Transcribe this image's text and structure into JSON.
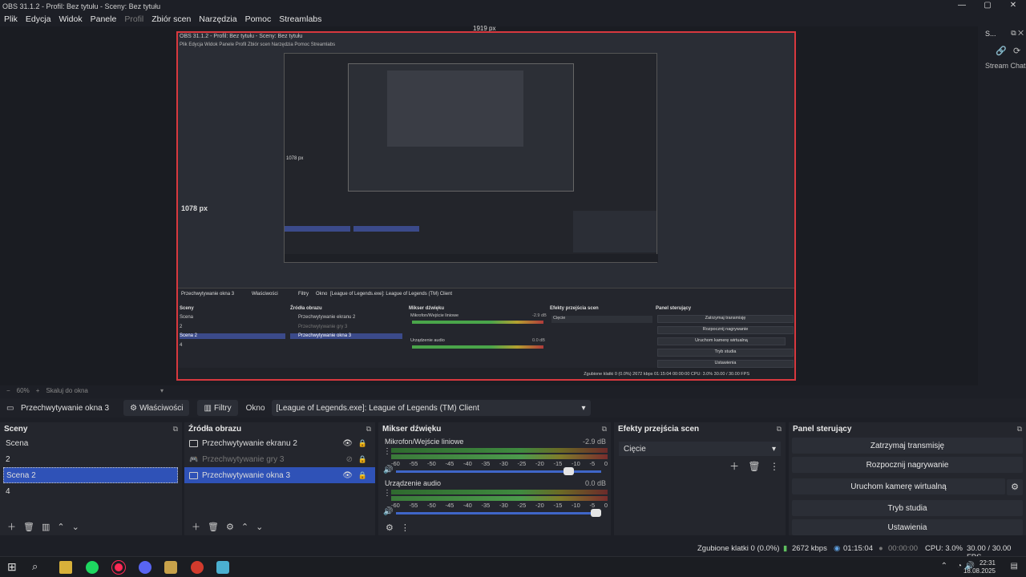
{
  "window": {
    "title": "OBS 31.1.2 - Profil: Bez tytułu - Sceny: Bez tytułu",
    "controls": [
      "—",
      "▢",
      "✕"
    ]
  },
  "menu": [
    "Plik",
    "Edycja",
    "Widok",
    "Panele",
    "Profil",
    "Zbiór scen",
    "Narzędzia",
    "Pomoc",
    "Streamlabs"
  ],
  "preview": {
    "top_px_label": "1919 px",
    "left_px_label": "1078 px",
    "nested": {
      "title": "OBS 31.1.2 - Profil: Bez tytułu - Sceny: Bez tytułu",
      "menu": "Plik  Edycja  Widok  Panele  Profil  Zbiór scen  Narzędzia  Pomoc  Streamlabs",
      "inner_px": "1078 px",
      "source_name": "Przechwytywanie okna 3",
      "props": "Właściwości",
      "filters": "Filtry",
      "okno": "Okno",
      "window_sel": "[League of Legends.exe]: League of Legends (TM) Client",
      "docks": {
        "scenes": "Sceny",
        "sources": "Źródła obrazu",
        "mixer": "Mikser dźwięku",
        "transitions": "Efekty przejścia scen",
        "controls": "Panel sterujący"
      },
      "scene_items": [
        "Scena",
        "2",
        "Scena 2",
        "4"
      ],
      "source_items": [
        "Przechwytywanie ekranu 2",
        "Przechwytywanie gry 3",
        "Przechwytywanie okna 3"
      ],
      "mic": "Mikrofon/Wejście liniowe",
      "mic_db": "-2.9 dB",
      "audio": "Urządzenie audio",
      "audio_db": "0.0 dB",
      "transition": "Cięcie",
      "buttons": [
        "Zatrzymaj transmisję",
        "Rozpocznij nagrywanie",
        "Uruchom kamerę wirtualną",
        "Tryb studia",
        "Ustawienia"
      ],
      "status": "Zgubione klatki 0 (0.0%)   2672 kbps   01:15:04   00:00:00   CPU: 3.0%   30.00 / 30.00 FPS"
    }
  },
  "right_dock": {
    "title": "S...",
    "label": "Stream Chat"
  },
  "zoom": {
    "minus": "−",
    "value": "60%",
    "plus": "+",
    "fit": "Skaluj do okna"
  },
  "source_bar": {
    "name": "Przechwytywanie okna 3",
    "properties": "Właściwości",
    "filters": "Filtry",
    "window_label": "Okno",
    "window_value": "[League of Legends.exe]: League of Legends (TM) Client"
  },
  "scenes": {
    "title": "Sceny",
    "items": [
      "Scena",
      "2",
      "Scena 2",
      "4"
    ],
    "selected": 2
  },
  "sources": {
    "title": "Źródła obrazu",
    "items": [
      {
        "label": "Przechwytywanie ekranu 2",
        "state": "visible"
      },
      {
        "label": "Przechwytywanie gry 3",
        "state": "hidden"
      },
      {
        "label": "Przechwytywanie okna 3",
        "state": "selected"
      }
    ]
  },
  "mixer": {
    "title": "Mikser dźwięku",
    "channels": [
      {
        "name": "Mikrofon/Wejście liniowe",
        "db": "-2.9 dB",
        "volume": 0.86
      },
      {
        "name": "Urządzenie audio",
        "db": "0.0 dB",
        "volume": 1.0
      }
    ],
    "scale": [
      "-60",
      "-55",
      "-50",
      "-45",
      "-40",
      "-35",
      "-30",
      "-25",
      "-20",
      "-15",
      "-10",
      "-5",
      "0"
    ]
  },
  "transitions": {
    "title": "Efekty przejścia scen",
    "selected": "Cięcie"
  },
  "controls": {
    "title": "Panel sterujący",
    "stop_stream": "Zatrzymaj transmisję",
    "start_record": "Rozpocznij nagrywanie",
    "virtual_cam": "Uruchom kamerę wirtualną",
    "studio_mode": "Tryb studia",
    "settings": "Ustawienia"
  },
  "status": {
    "dropped": "Zgubione klatki 0 (0.0%)",
    "bitrate": "2672 kbps",
    "stream_time": "01:15:04",
    "rec_time": "00:00:00",
    "cpu": "CPU: 3.0%",
    "fps": "30.00 / 30.00 FPS"
  },
  "taskbar": {
    "time": "22:31",
    "date": "18.08.2025"
  },
  "colors": {
    "accent": "#2f52b7",
    "live_border": "#d8383e",
    "bg": "#1d1f26"
  }
}
